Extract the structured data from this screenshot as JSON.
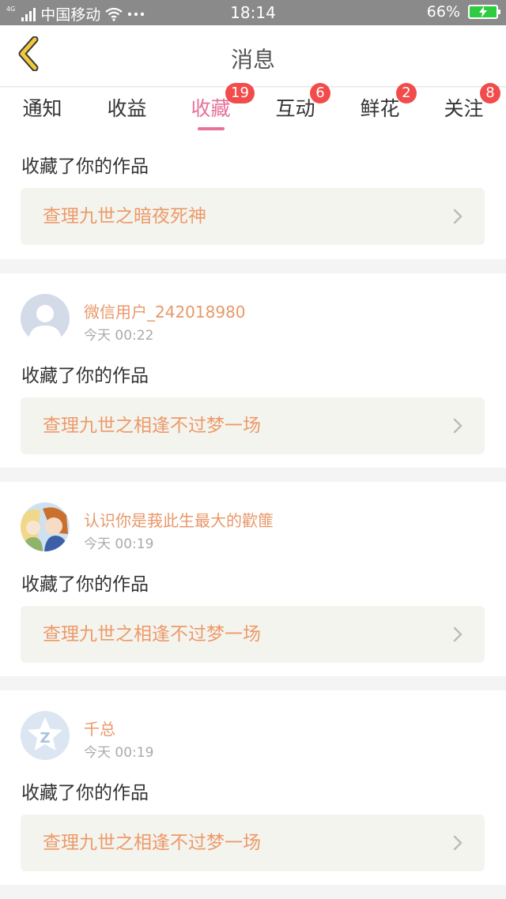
{
  "status_bar": {
    "network_type": "4G",
    "carrier": "中国移动",
    "time": "18:14",
    "battery": "66%",
    "battery_color": "#2ecc40"
  },
  "nav": {
    "title": "消息",
    "back_icon": "chevron-left-icon",
    "back_color": "#f3c93c"
  },
  "tabs": [
    {
      "label": "通知",
      "badge": ""
    },
    {
      "label": "收益",
      "badge": ""
    },
    {
      "label": "收藏",
      "badge": "19",
      "active": true
    },
    {
      "label": "互动",
      "badge": "6"
    },
    {
      "label": "鲜花",
      "badge": "2"
    },
    {
      "label": "关注",
      "badge": "8"
    }
  ],
  "colors": {
    "accent": "#e8719b",
    "badge": "#f24b4b",
    "username": "#e8986a",
    "work_title": "#ec9a6a"
  },
  "notifications": [
    {
      "action": "收藏了你的作品",
      "work_title": "查理九世之暗夜死神"
    },
    {
      "user": "微信用户_242018980",
      "time": "今天 00:22",
      "avatar": "default-user-avatar",
      "action": "收藏了你的作品",
      "work_title": "查理九世之相逢不过梦一场"
    },
    {
      "user": "认识你是莪此生最大的歡篚",
      "time": "今天 00:19",
      "avatar": "anime-character-avatar",
      "action": "收藏了你的作品",
      "work_title": "查理九世之相逢不过梦一场"
    },
    {
      "user": "千总",
      "time": "今天 00:19",
      "avatar": "qzone-star-avatar",
      "action": "收藏了你的作品",
      "work_title": "查理九世之相逢不过梦一场"
    }
  ]
}
